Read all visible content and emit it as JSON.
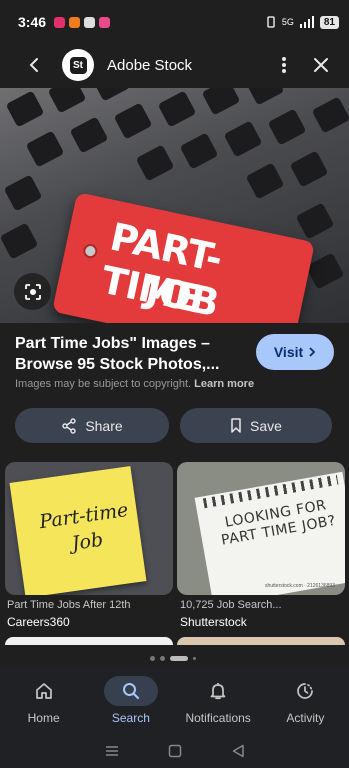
{
  "status_bar": {
    "time": "3:46",
    "network": "5G",
    "battery": "81"
  },
  "app_bar": {
    "site_logo": "St",
    "title": "Adobe Stock"
  },
  "hero": {
    "tag_line1": "PART-TIME",
    "tag_line2": "JOB"
  },
  "result": {
    "title": "Part Time Jobs\" Images – Browse 95 Stock Photos,...",
    "visit_label": "Visit",
    "copyright_text": "Images may be subject to copyright.",
    "learn_more": "Learn more"
  },
  "actions": {
    "share_label": "Share",
    "save_label": "Save"
  },
  "related": [
    {
      "image_text": "Part-time Job",
      "caption": "Part Time Jobs After 12th",
      "source": "Careers360"
    },
    {
      "image_text": "LOOKING FOR PART TIME JOB?",
      "watermark": "shutterstock.com · 2126136893",
      "caption": "10,725 Job Search...",
      "source": "Shutterstock"
    }
  ],
  "bottom_nav": [
    {
      "label": "Home",
      "icon": "home-icon"
    },
    {
      "label": "Search",
      "icon": "search-icon",
      "active": true
    },
    {
      "label": "Notifications",
      "icon": "bell-icon"
    },
    {
      "label": "Activity",
      "icon": "activity-icon"
    }
  ],
  "colors": {
    "accent": "#a8c7fa",
    "tag_red": "#e33a3c",
    "background": "#1f1f1f"
  }
}
